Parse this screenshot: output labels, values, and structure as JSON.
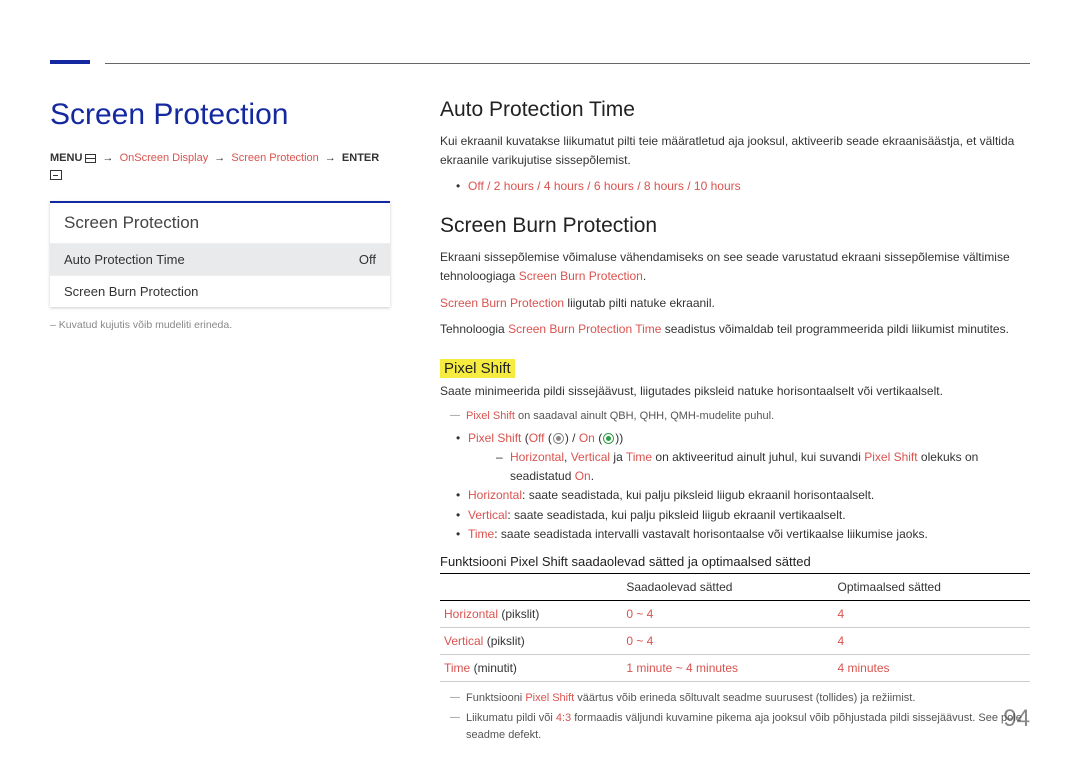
{
  "page_number": "94",
  "left": {
    "title": "Screen Protection",
    "breadcrumb": {
      "menu": "MENU",
      "onscreen": "OnScreen Display",
      "screenprot": "Screen Protection",
      "enter": "ENTER"
    },
    "panel": {
      "title": "Screen Protection",
      "row1_label": "Auto Protection Time",
      "row1_value": "Off",
      "row2_label": "Screen Burn Protection"
    },
    "note": "Kuvatud kujutis võib mudeliti erineda."
  },
  "right": {
    "apt": {
      "heading": "Auto Protection Time",
      "para": "Kui ekraanil kuvatakse liikumatut pilti teie määratletud aja jooksul, aktiveerib seade ekraanisäästja, et vältida ekraanile varikujutise sissepõlemist.",
      "options_off": "Off",
      "options_rest": " / 2 hours / 4 hours / 6 hours / 8 hours / 10 hours"
    },
    "sbp": {
      "heading": "Screen Burn Protection",
      "p1a": "Ekraani sissepõlemise võimaluse vähendamiseks on see seade varustatud ekraani sissepõlemise vältimise tehnoloogiaga ",
      "p1b": "Screen Burn Protection",
      "p1c": ".",
      "p2a": "Screen Burn Protection",
      "p2b": " liigutab pilti natuke ekraanil.",
      "p3a": "Tehnoloogia ",
      "p3b": "Screen Burn Protection Time",
      "p3c": " seadistus võimaldab teil programmeerida pildi liikumist minutites."
    },
    "pixel": {
      "heading": "Pixel Shift",
      "p1": "Saate minimeerida pildi sissejäävust, liigutades piksleid natuke horisontaalselt või vertikaalselt.",
      "note1a": "Pixel Shift",
      "note1b": " on saadaval ainult QBH, QHH, QMH-mudelite puhul.",
      "b1a": "Pixel Shift",
      "b1b": " (",
      "b1c": "Off",
      "b1d": " (",
      "b1e": ") / ",
      "b1f": "On",
      "b1g": " (",
      "b1h": "))",
      "d1a": "Horizontal",
      "d1b": ", ",
      "d1c": "Vertical",
      "d1d": " ja ",
      "d1e": "Time",
      "d1f": " on aktiveeritud ainult juhul, kui suvandi ",
      "d1g": "Pixel Shift",
      "d1h": " olekuks on seadistatud ",
      "d1i": "On",
      "d1j": ".",
      "b2a": "Horizontal",
      "b2b": ": saate seadistada, kui palju piksleid liigub ekraanil horisontaalselt.",
      "b3a": "Vertical",
      "b3b": ": saate seadistada, kui palju piksleid liigub ekraanil vertikaalselt.",
      "b4a": "Time",
      "b4b": ": saate seadistada intervalli vastavalt horisontaalse või vertikaalse liikumise jaoks."
    },
    "tablesec": {
      "heading": "Funktsiooni Pixel Shift saadaolevad sätted ja optimaalsed sätted",
      "th1": "",
      "th2": "Saadaolevad sätted",
      "th3": "Optimaalsed sätted",
      "rows": [
        {
          "c1a": "Horizontal",
          "c1b": " (pikslit)",
          "c2": "0 ~ 4",
          "c3": "4"
        },
        {
          "c1a": "Vertical",
          "c1b": " (pikslit)",
          "c2": "0 ~ 4",
          "c3": "4"
        },
        {
          "c1a": "Time",
          "c1b": " (minutit)",
          "c2": "1 minute ~ 4 minutes",
          "c3": "4 minutes"
        }
      ],
      "fn1a": "Funktsiooni ",
      "fn1b": "Pixel Shift",
      "fn1c": " väärtus võib erineda sõltuvalt seadme suurusest (tollides) ja režiimist.",
      "fn2a": "Liikumatu pildi või ",
      "fn2b": "4:3",
      "fn2c": " formaadis väljundi kuvamine pikema aja jooksul võib põhjustada pildi sissejäävust. See pole seadme defekt."
    }
  }
}
